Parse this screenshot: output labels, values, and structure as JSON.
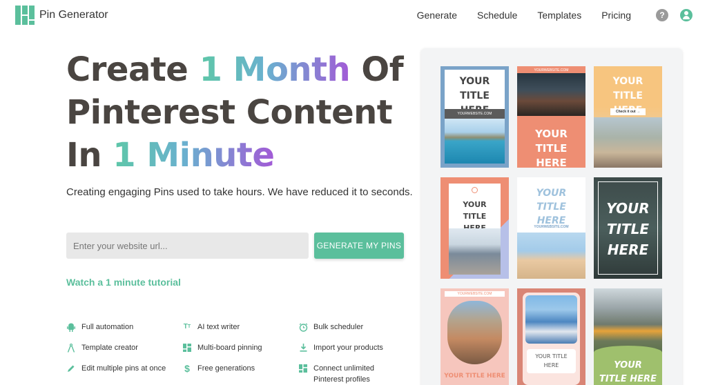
{
  "brand": {
    "name": "Pin Generator"
  },
  "nav": {
    "items": [
      "Generate",
      "Schedule",
      "Templates",
      "Pricing"
    ],
    "help_icon_glyph": "?"
  },
  "hero": {
    "line1_a": "Create ",
    "line1_b": "1 Month",
    "line1_c": " Of",
    "line2": "Pinterest Content",
    "line3_a": "In ",
    "line3_b": "1 Minute",
    "subtitle": "Creating engaging Pins used to take hours. We have reduced it to seconds."
  },
  "form": {
    "placeholder": "Enter your website url...",
    "button": "GENERATE MY PINS"
  },
  "tutorial": "Watch a 1 minute tutorial",
  "features": [
    {
      "label": "Full automation",
      "icon": "android-icon"
    },
    {
      "label": "AI text writer",
      "icon": "text-size-icon"
    },
    {
      "label": "Bulk scheduler",
      "icon": "alarm-clock-icon"
    },
    {
      "label": "Template creator",
      "icon": "compass-icon"
    },
    {
      "label": "Multi-board pinning",
      "icon": "grid-icon"
    },
    {
      "label": "Import your products",
      "icon": "download-icon"
    },
    {
      "label": "Edit multiple pins at once",
      "icon": "pencil-icon"
    },
    {
      "label": "Free generations",
      "icon": "dollar-icon"
    },
    {
      "label": "Connect unlimited Pinterest profiles",
      "icon": "grid-icon"
    }
  ],
  "pins": {
    "p1": {
      "title": "YOUR TITLE HERE",
      "site": "YOURWEBSITE.COM"
    },
    "p2": {
      "title": "YOUR TITLE HERE",
      "site": "YOURWEBSITE.COM"
    },
    "p3": {
      "title": "YOUR TITLE HERE",
      "cta": "Check it out →"
    },
    "p4": {
      "title": "YOUR TITLE HERE"
    },
    "p5": {
      "title": "YOUR TITLE HERE",
      "site": "YOURWEBSITE.COM"
    },
    "p6": {
      "title": "YOUR TITLE HERE"
    },
    "p7": {
      "title": "YOUR TITLE HERE",
      "site": "YOURWEBSITE.COM"
    },
    "p8": {
      "title": "YOUR TITLE HERE"
    },
    "p9": {
      "title": "YOUR TITLE HERE"
    }
  },
  "colors": {
    "accent": "#5bbf9c",
    "heading": "#4a4541"
  }
}
